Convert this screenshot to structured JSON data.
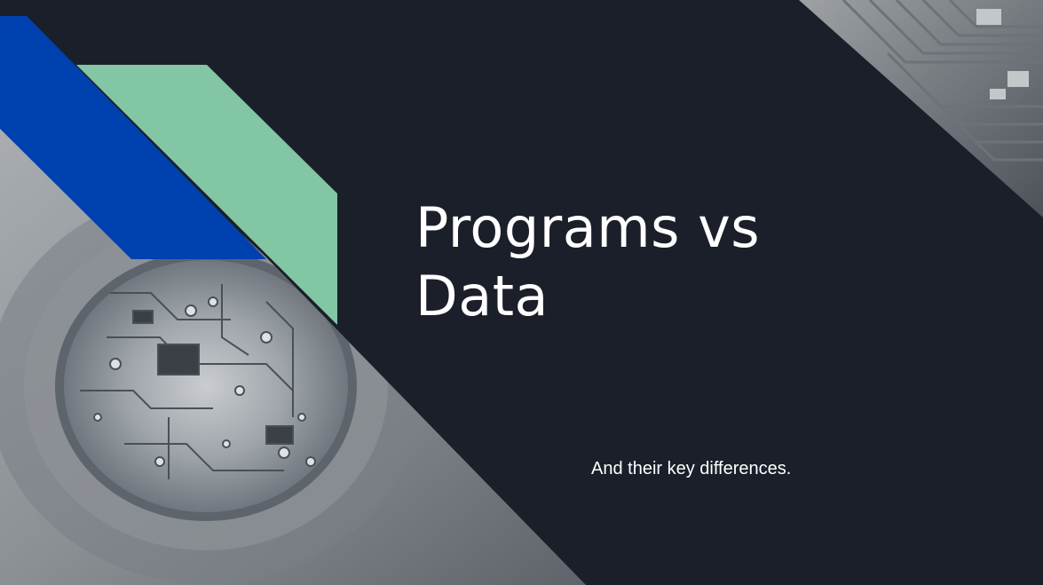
{
  "slide": {
    "title_line1": "Programs vs",
    "title_line2": "Data",
    "subtitle": "And their key differences."
  },
  "decor": {
    "background_color": "#1b1f2a",
    "blue_band_color": "#0041b0",
    "green_band_color": "#82c6a4",
    "photo_subject": "circuit board seen through a lens",
    "corner_subject": "circuit board traces"
  }
}
